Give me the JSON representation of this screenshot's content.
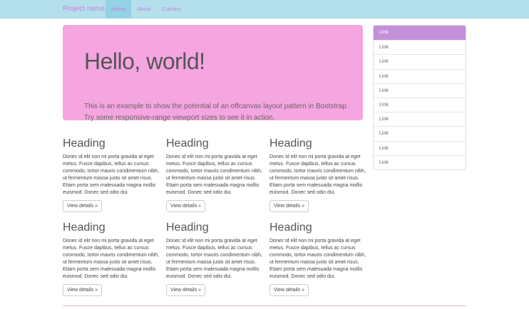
{
  "navbar": {
    "brand": "Project name",
    "links": [
      {
        "label": "Home"
      },
      {
        "label": "About"
      },
      {
        "label": "Contact"
      }
    ]
  },
  "jumbotron": {
    "title": "Hello, world!",
    "line1": "This is an example to show the potential of an offcanvas layout pattern in Bootstrap.",
    "line2": "Try some responsive-range viewport sizes to see it in action."
  },
  "cards": [
    {
      "heading": "Heading",
      "body": "Donec id elit non mi porta gravida at eget metus. Fusce dapibus, tellus ac cursus commodo, tortor mauris condimentum nibh, ut fermentum massa justo sit amet risus. Etiam porta sem malesuada magna mollis euismod. Donec sed odio dui.",
      "button": "View details »"
    },
    {
      "heading": "Heading",
      "body": "Donec id elit non mi porta gravida at eget metus. Fusce dapibus, tellus ac cursus commodo, tortor mauris condimentum nibh, ut fermentum massa justo sit amet risus. Etiam porta sem malesuada magna mollis euismod. Donec sed odio dui.",
      "button": "View details »"
    },
    {
      "heading": "Heading",
      "body": "Donec id elit non mi porta gravida at eget metus. Fusce dapibus, tellus ac cursus commodo, tortor mauris condimentum nibh, ut fermentum massa justo sit amet risus. Etiam porta sem malesuada magna mollis euismod. Donec sed odio dui.",
      "button": "View details »"
    },
    {
      "heading": "Heading",
      "body": "Donec id elit non mi porta gravida at eget metus. Fusce dapibus, tellus ac cursus commodo, tortor mauris condimentum nibh, ut fermentum massa justo sit amet risus. Etiam porta sem malesuada magna mollis euismod. Donec sed odio dui.",
      "button": "View details »"
    },
    {
      "heading": "Heading",
      "body": "Donec id elit non mi porta gravida at eget metus. Fusce dapibus, tellus ac cursus commodo, tortor mauris condimentum nibh, ut fermentum massa justo sit amet risus. Etiam porta sem malesuada magna mollis euismod. Donec sed odio dui.",
      "button": "View details »"
    },
    {
      "heading": "Heading",
      "body": "Donec id elit non mi porta gravida at eget metus. Fusce dapibus, tellus ac cursus commodo, tortor mauris condimentum nibh, ut fermentum massa justo sit amet risus. Etiam porta sem malesuada magna mollis euismod. Donec sed odio dui.",
      "button": "View details »"
    }
  ],
  "sidebar": {
    "links": [
      "Link",
      "Link",
      "Link",
      "Link",
      "Link",
      "Link",
      "Link",
      "Link",
      "Link",
      "Link"
    ]
  },
  "colors": {
    "navbar_bg": "#b4e0ec",
    "nav_active_bg": "#94d2e5",
    "link_color": "#c57ed8",
    "jumbotron_bg": "#f5a5e0",
    "sidebar_active_bg": "#c590d9"
  }
}
